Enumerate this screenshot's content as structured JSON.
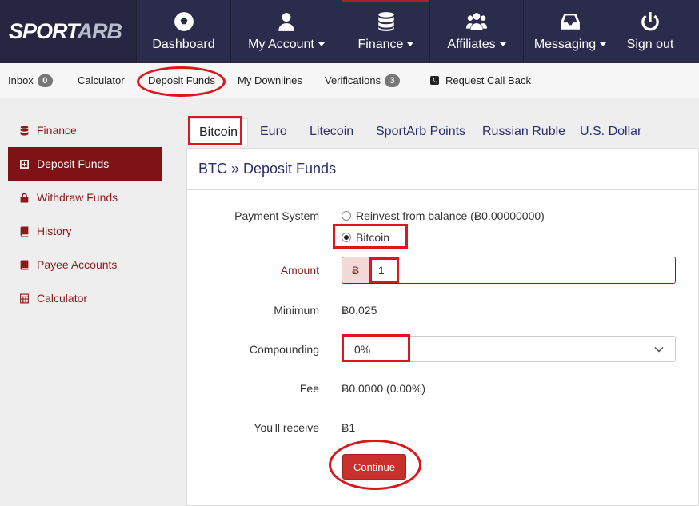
{
  "brand": {
    "logo_main": "SPORT",
    "logo_accent": "ARB"
  },
  "topnav": {
    "items": [
      {
        "label": "Dashboard",
        "icon": "soccer-ball-icon",
        "dropdown": false
      },
      {
        "label": "My Account",
        "icon": "user-icon",
        "dropdown": true
      },
      {
        "label": "Finance",
        "icon": "database-icon",
        "dropdown": true
      },
      {
        "label": "Affiliates",
        "icon": "users-icon",
        "dropdown": true
      },
      {
        "label": "Messaging",
        "icon": "inbox-icon",
        "dropdown": true
      },
      {
        "label": "Sign out",
        "icon": "power-icon",
        "dropdown": false
      }
    ],
    "active_index": 2
  },
  "subnav": {
    "inbox_label": "Inbox",
    "inbox_count": "0",
    "calculator_label": "Calculator",
    "deposit_label": "Deposit Funds",
    "downlines_label": "My Downlines",
    "verifications_label": "Verifications",
    "verifications_count": "3",
    "callback_label": "Request Call Back"
  },
  "sidebar": {
    "items": [
      {
        "label": "Finance",
        "icon": "database-icon"
      },
      {
        "label": "Deposit Funds",
        "icon": "plus-square-icon"
      },
      {
        "label": "Withdraw Funds",
        "icon": "lock-icon"
      },
      {
        "label": "History",
        "icon": "book-icon"
      },
      {
        "label": "Payee Accounts",
        "icon": "book-icon"
      },
      {
        "label": "Calculator",
        "icon": "calculator-icon"
      }
    ],
    "active_index": 1
  },
  "tabs": [
    "Bitcoin",
    "Euro",
    "Litecoin",
    "SportArb Points",
    "Russian Ruble",
    "U.S. Dollar"
  ],
  "panel": {
    "title": "BTC » Deposit Funds",
    "payment_system_label": "Payment System",
    "option_reinvest": "Reinvest from balance (Ƀ0.00000000)",
    "option_bitcoin": "Bitcoin",
    "amount_label": "Amount",
    "amount_symbol": "Ƀ",
    "amount_value": "1",
    "minimum_label": "Minimum",
    "minimum_value": "Ƀ0.025",
    "compounding_label": "Compounding",
    "compounding_value": "0%",
    "fee_label": "Fee",
    "fee_value": "Ƀ0.0000 (0.00%)",
    "receive_label": "You'll receive",
    "receive_value": "Ƀ1",
    "continue_label": "Continue"
  },
  "colors": {
    "navbar": "#2b2b4b",
    "accent_dark_red": "#7e1215",
    "button_red": "#c9302c",
    "annotation_red": "#e0141c",
    "link_navy": "#2a2d6e"
  }
}
